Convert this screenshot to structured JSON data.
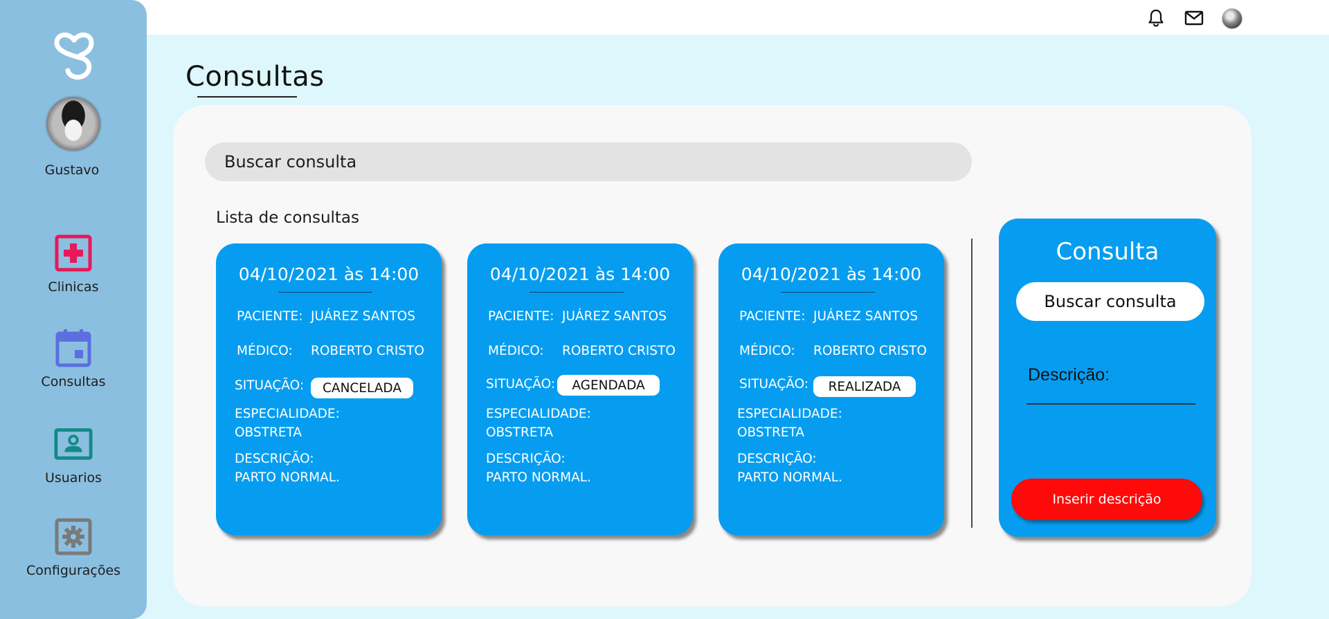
{
  "app": {
    "user_name": "Gustavo"
  },
  "topbar": {
    "icons": [
      "bell-icon",
      "mail-icon",
      "user-avatar"
    ]
  },
  "sidebar": {
    "items": [
      {
        "label": "Clinicas",
        "icon": "hospital-cross-icon",
        "color": "#E8185A"
      },
      {
        "label": "Consultas",
        "icon": "calendar-icon",
        "color": "#5B6FE0"
      },
      {
        "label": "Usuarios",
        "icon": "user-card-icon",
        "color": "#138A87"
      },
      {
        "label": "Configurações",
        "icon": "gear-icon",
        "color": "#7A7A7A"
      }
    ]
  },
  "main": {
    "title": "Consultas",
    "search_placeholder": "Buscar consulta",
    "list_title": "Lista de consultas",
    "cards": [
      {
        "date": "04/10/2021 às 14:00",
        "patient_label": "PACIENTE:",
        "patient": "JUÁREZ SANTOS",
        "doctor_label": "MÉDICO:",
        "doctor": "ROBERTO CRISTO",
        "status_label": "SITUAÇÃO:",
        "status": "CANCELADA",
        "specialty_label": "ESPECIALIDADE:",
        "specialty": "OBSTRETA",
        "description_label": "DESCRIÇÃO:",
        "description": "PARTO NORMAL."
      },
      {
        "date": "04/10/2021 às 14:00",
        "patient_label": "PACIENTE:",
        "patient": "JUÁREZ SANTOS",
        "doctor_label": "MÉDICO:",
        "doctor": "ROBERTO CRISTO",
        "status_label": "SITUAÇÃO:",
        "status": "AGENDADA",
        "specialty_label": "ESPECIALIDADE:",
        "specialty": "OBSTRETA",
        "description_label": "DESCRIÇÃO:",
        "description": "PARTO NORMAL."
      },
      {
        "date": "04/10/2021 às 14:00",
        "patient_label": "PACIENTE:",
        "patient": "JUÁREZ SANTOS",
        "doctor_label": "MÉDICO:",
        "doctor": "ROBERTO CRISTO",
        "status_label": "SITUAÇÃO:",
        "status": "REALIZADA",
        "specialty_label": "ESPECIALIDADE:",
        "specialty": "OBSTRETA",
        "description_label": "DESCRIÇÃO:",
        "description": "PARTO NORMAL."
      }
    ]
  },
  "detail": {
    "title": "Consulta",
    "search_placeholder": "Buscar consulta",
    "description_label": "Descrição:",
    "button_label": "Inserir descrição"
  },
  "colors": {
    "background": "#DDF7FC",
    "sidebar": "#8BBFE0",
    "card": "#069DF0",
    "button": "#FF0A0A",
    "panel": "#F8F8F8"
  }
}
